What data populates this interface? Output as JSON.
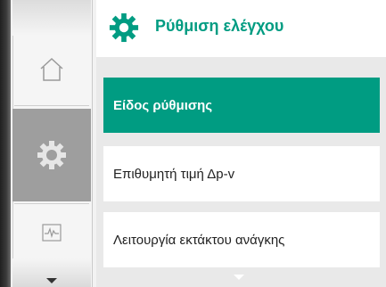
{
  "header": {
    "title": "Ρύθμιση ελέγχου",
    "icon": "gear-icon",
    "accent_color": "#009c82"
  },
  "rail": {
    "items": [
      {
        "name": "home",
        "icon": "home-icon",
        "active": false
      },
      {
        "name": "settings",
        "icon": "gear-icon",
        "active": true
      },
      {
        "name": "diagnostics",
        "icon": "waveform-icon",
        "active": false
      }
    ]
  },
  "menu": {
    "items": [
      {
        "label": "Είδος ρύθμισης",
        "selected": true
      },
      {
        "label": "Επιθυμητή τιμή Δp-v",
        "selected": false
      },
      {
        "label": "Λειτουργία εκτάκτου ανάγκης",
        "selected": false
      }
    ],
    "selected_color": "#009c82"
  }
}
